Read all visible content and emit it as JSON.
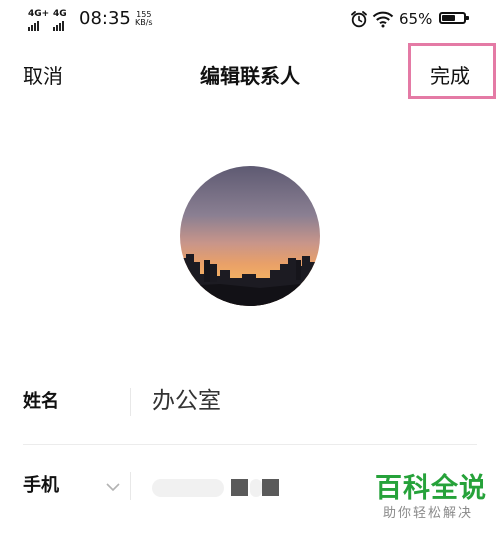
{
  "status_bar": {
    "signal1_label": "4G+",
    "signal2_label": "4G",
    "time": "08:35",
    "speed_value": "155",
    "speed_unit": "KB/s",
    "icons": [
      "alarm-icon",
      "wifi-icon"
    ],
    "battery_pct": "65%",
    "battery_level": 0.65
  },
  "nav": {
    "cancel_label": "取消",
    "title": "编辑联系人",
    "done_label": "完成",
    "highlight_color": "#e47aa5"
  },
  "avatar": {
    "description_icon": "sunset-city-photo"
  },
  "fields": {
    "name": {
      "label": "姓名",
      "value": "办公室"
    },
    "phone": {
      "label": "手机",
      "icon": "chevron-down-icon"
    }
  },
  "watermark": {
    "title": "百科全说",
    "subtitle": "助你轻松解决",
    "color": "#26a23a"
  }
}
